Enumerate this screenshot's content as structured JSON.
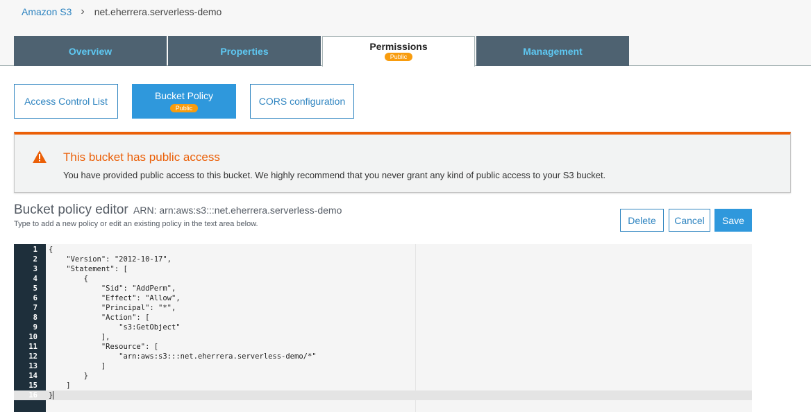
{
  "breadcrumb": {
    "root": "Amazon S3",
    "separator": "›",
    "bucket": "net.eherrera.serverless-demo"
  },
  "tabs": [
    {
      "label": "Overview",
      "active": false
    },
    {
      "label": "Properties",
      "active": false
    },
    {
      "label": "Permissions",
      "active": true,
      "badge": "Public"
    },
    {
      "label": "Management",
      "active": false
    }
  ],
  "subtabs": {
    "acl": "Access Control List",
    "bucket_policy": "Bucket Policy",
    "bucket_policy_badge": "Public",
    "cors": "CORS configuration"
  },
  "alert": {
    "icon": "warning-icon",
    "title": "This bucket has public access",
    "body": "You have provided public access to this bucket. We highly recommend that you never grant any kind of public access to your S3 bucket."
  },
  "editor": {
    "title": "Bucket policy editor",
    "arn": "ARN: arn:aws:s3:::net.eherrera.serverless-demo",
    "hint": "Type to add a new policy or edit an existing policy in the text area below.",
    "delete_label": "Delete",
    "cancel_label": "Cancel",
    "save_label": "Save",
    "lines": [
      "{",
      "    \"Version\": \"2012-10-17\",",
      "    \"Statement\": [",
      "        {",
      "            \"Sid\": \"AddPerm\",",
      "            \"Effect\": \"Allow\",",
      "            \"Principal\": \"*\",",
      "            \"Action\": [",
      "                \"s3:GetObject\"",
      "            ],",
      "            \"Resource\": [",
      "                \"arn:aws:s3:::net.eherrera.serverless-demo/*\"",
      "            ]",
      "        }",
      "    ]",
      "}"
    ]
  },
  "colors": {
    "tab_bg": "#4e6271",
    "tab_text": "#5ec8f2",
    "accent_blue": "#2f98dc",
    "badge_orange": "#f89c0e",
    "warning_orange": "#eb5f07",
    "gutter": "#1e2f3b"
  }
}
